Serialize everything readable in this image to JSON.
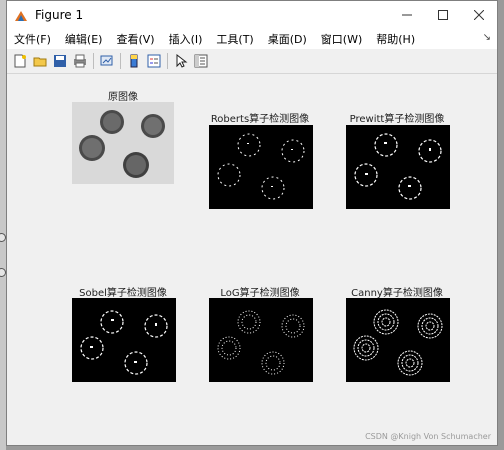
{
  "window": {
    "title": "Figure 1"
  },
  "menu": [
    {
      "label": "文件(F)"
    },
    {
      "label": "编辑(E)"
    },
    {
      "label": "查看(V)"
    },
    {
      "label": "插入(I)"
    },
    {
      "label": "工具(T)"
    },
    {
      "label": "桌面(D)"
    },
    {
      "label": "窗口(W)"
    },
    {
      "label": "帮助(H)"
    }
  ],
  "toolbar": [
    "new-figure-icon",
    "open-icon",
    "save-icon",
    "print-icon",
    "link-plot-icon",
    "colorbar-icon",
    "legend-icon",
    "pointer-icon",
    "property-editor-icon"
  ],
  "panels": [
    {
      "title": "原图像"
    },
    {
      "title": "Roberts算子检测图像"
    },
    {
      "title": "Prewitt算子检测图像"
    },
    {
      "title": "Sobel算子检测图像"
    },
    {
      "title": "LoG算子检测图像"
    },
    {
      "title": "Canny算子检测图像"
    }
  ],
  "watermark": "CSDN @Knigh Von Schumacher",
  "colors": {
    "image_bg": "#000000",
    "edge": "#ffffff",
    "window_bg": "#f0f0f0"
  }
}
